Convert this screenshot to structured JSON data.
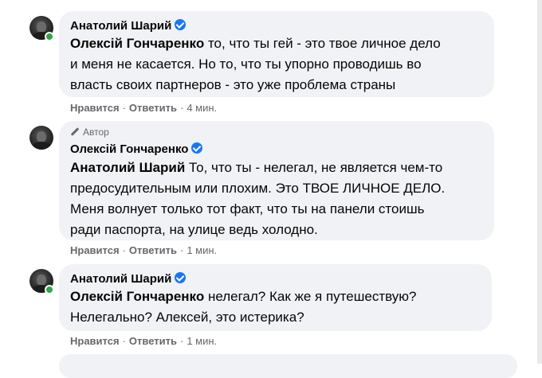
{
  "comments": [
    {
      "author": "Анатолий Шарий",
      "author_badge": "",
      "mention": "Олексій Гончаренко",
      "lines": [
        " то, что ты гей - это твое личное дело",
        "и меня не касается. Но то, что ты упорно проводишь во",
        "власть своих партнеров - это уже проблема страны"
      ],
      "like_label": "Нравится",
      "reply_label": "Ответить",
      "time": "4 мин."
    },
    {
      "author": "Олексій Гончаренко",
      "author_badge": "Автор",
      "mention": "Анатолий Шарий",
      "lines": [
        " То, что ты - нелегал, не является чем-то",
        "предосудительным или плохим. Это ТВОЕ ЛИЧНОЕ ДЕЛО.",
        "Меня волнует только тот факт, что ты на панели стоишь",
        "ради паспорта, на улице ведь холодно."
      ],
      "like_label": "Нравится",
      "reply_label": "Ответить",
      "time": "1 мин."
    },
    {
      "author": "Анатолий Шарий",
      "author_badge": "",
      "mention": "Олексій Гончаренко",
      "lines": [
        " нелегал? Как же я путешествую?",
        "Нелегально? Алексей, это истерика?"
      ],
      "like_label": "Нравится",
      "reply_label": "Ответить",
      "time": "1 мин."
    }
  ],
  "icons": {
    "verified": "verified-badge-icon",
    "author": "pencil-icon",
    "online": "online-status-icon"
  },
  "colors": {
    "bubble": "#f0f2f5",
    "verified": "#1877f2",
    "online": "#31a24c",
    "meta": "#65676b"
  }
}
